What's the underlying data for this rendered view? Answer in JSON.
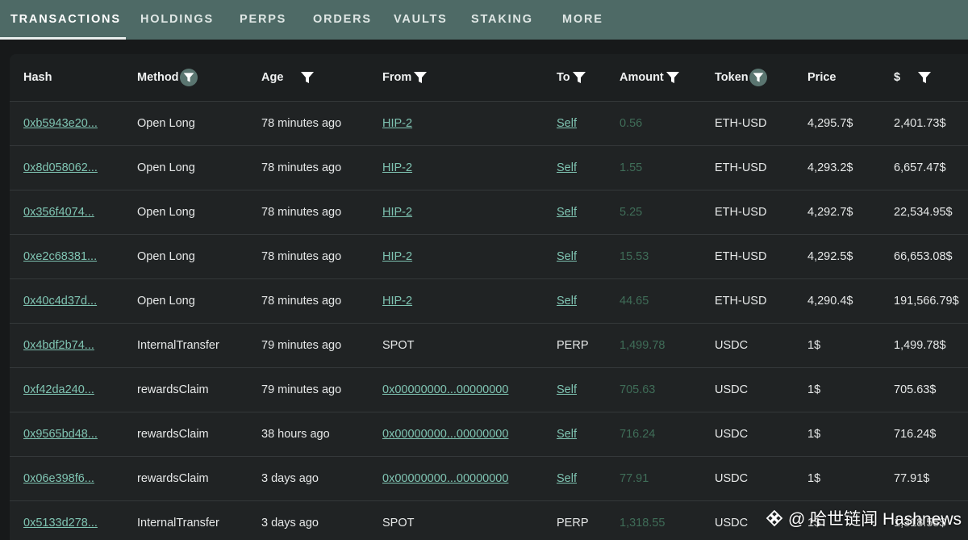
{
  "tabs": [
    {
      "label": "TRANSACTIONS",
      "active": true
    },
    {
      "label": "HOLDINGS"
    },
    {
      "label": "PERPS"
    },
    {
      "label": "ORDERS"
    },
    {
      "label": "VAULTS"
    },
    {
      "label": "STAKING"
    },
    {
      "label": "MORE"
    }
  ],
  "columns": {
    "hash": "Hash",
    "method": "Method",
    "age": "Age",
    "from": "From",
    "to": "To",
    "amount": "Amount",
    "token": "Token",
    "price": "Price",
    "usd": "$"
  },
  "rows": [
    {
      "hash": "0xb5943e20...",
      "method": "Open Long",
      "age": "78 minutes ago",
      "from": "HIP-2",
      "to": "Self",
      "amount": "0.56",
      "token": "ETH-USD",
      "price": "4,295.7$",
      "usd": "2,401.73$"
    },
    {
      "hash": "0x8d058062...",
      "method": "Open Long",
      "age": "78 minutes ago",
      "from": "HIP-2",
      "to": "Self",
      "amount": "1.55",
      "token": "ETH-USD",
      "price": "4,293.2$",
      "usd": "6,657.47$"
    },
    {
      "hash": "0x356f4074...",
      "method": "Open Long",
      "age": "78 minutes ago",
      "from": "HIP-2",
      "to": "Self",
      "amount": "5.25",
      "token": "ETH-USD",
      "price": "4,292.7$",
      "usd": "22,534.95$"
    },
    {
      "hash": "0xe2c68381...",
      "method": "Open Long",
      "age": "78 minutes ago",
      "from": "HIP-2",
      "to": "Self",
      "amount": "15.53",
      "token": "ETH-USD",
      "price": "4,292.5$",
      "usd": "66,653.08$"
    },
    {
      "hash": "0x40c4d37d...",
      "method": "Open Long",
      "age": "78 minutes ago",
      "from": "HIP-2",
      "to": "Self",
      "amount": "44.65",
      "token": "ETH-USD",
      "price": "4,290.4$",
      "usd": "191,566.79$"
    },
    {
      "hash": "0x4bdf2b74...",
      "method": "InternalTransfer",
      "age": "79 minutes ago",
      "from": "SPOT",
      "to": "PERP",
      "amount": "1,499.78",
      "token": "USDC",
      "price": "1$",
      "usd": "1,499.78$"
    },
    {
      "hash": "0xf42da240...",
      "method": "rewardsClaim",
      "age": "79 minutes ago",
      "from": "0x00000000...00000000",
      "to": "Self",
      "amount": "705.63",
      "token": "USDC",
      "price": "1$",
      "usd": "705.63$"
    },
    {
      "hash": "0x9565bd48...",
      "method": "rewardsClaim",
      "age": "38 hours ago",
      "from": "0x00000000...00000000",
      "to": "Self",
      "amount": "716.24",
      "token": "USDC",
      "price": "1$",
      "usd": "716.24$"
    },
    {
      "hash": "0x06e398f6...",
      "method": "rewardsClaim",
      "age": "3 days ago",
      "from": "0x00000000...00000000",
      "to": "Self",
      "amount": "77.91",
      "token": "USDC",
      "price": "1$",
      "usd": "77.91$"
    },
    {
      "hash": "0x5133d278...",
      "method": "InternalTransfer",
      "age": "3 days ago",
      "from": "SPOT",
      "to": "PERP",
      "amount": "1,318.55",
      "token": "USDC",
      "price": "1$",
      "usd": "1,318.55$"
    }
  ],
  "watermark": "@ 哈世链闻 Hashnews",
  "colors": {
    "tabbar": "#4e6a66",
    "link": "#7fc4b2",
    "amount": "#3f6d58",
    "panel": "#202324"
  }
}
